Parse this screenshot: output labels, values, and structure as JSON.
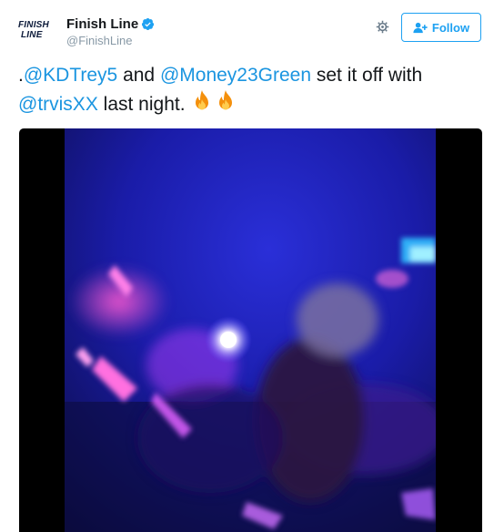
{
  "account": {
    "logo_line1": "FINISH",
    "logo_line2": "LINE",
    "display_name": "Finish Line",
    "handle": "@FinishLine",
    "verified": true
  },
  "actions": {
    "follow_label": "Follow",
    "follow_icon": "add-user-icon",
    "settings_icon": "gear-icon"
  },
  "tweet": {
    "prefix": ".",
    "mention1": "@KDTrey5",
    "text1": " and ",
    "mention2": "@Money23Green",
    "text2": " set it off with ",
    "mention3": "@trvisXX",
    "text3": " last night.",
    "emoji": [
      "fire-icon",
      "fire-icon"
    ]
  },
  "colors": {
    "accent": "#1da1f2",
    "mention": "#1b95e0",
    "muted": "#8899a6"
  }
}
